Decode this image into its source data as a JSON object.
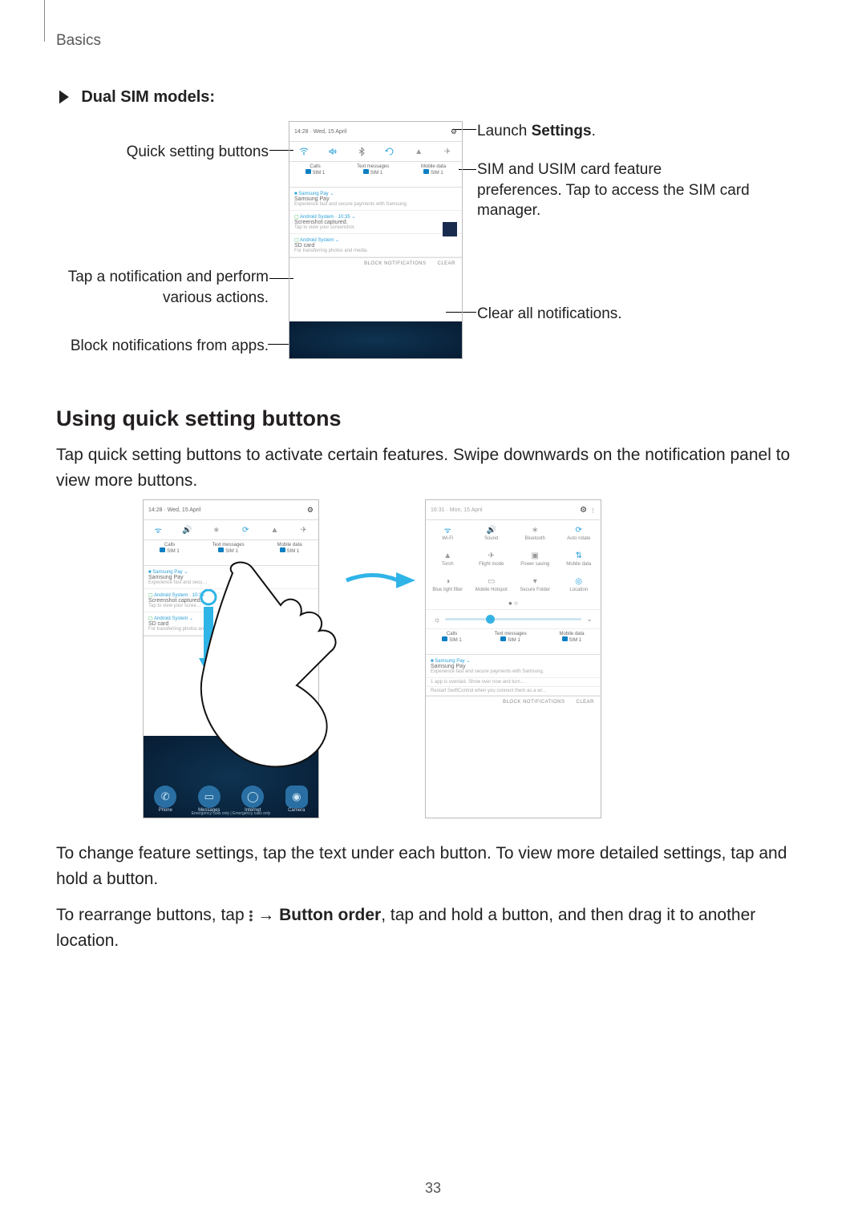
{
  "section_label": "Basics",
  "subhead_marker": "►",
  "subhead_text": "Dual SIM models:",
  "fig1": {
    "callouts": {
      "quick_settings": "Quick setting buttons",
      "tap_notification": "Tap a notification and perform various actions.",
      "block_notifications": "Block notifications from apps.",
      "launch_settings": "Launch Settings.",
      "sim_prefs": "SIM and USIM card feature preferences. Tap to access the SIM card manager.",
      "clear_all": "Clear all notifications."
    },
    "statusbar_time": "14:28",
    "statusbar_date": "Wed, 15 April",
    "sim_labels": [
      "Calls",
      "Text messages",
      "Mobile data"
    ],
    "sim_name": "SIM 1",
    "notifications": [
      {
        "app": "Samsung Pay",
        "title": "Samsung Pay",
        "body": "Experience fast and secure payments with Samsung."
      },
      {
        "app": "Android System · 10:35",
        "title": "Screenshot captured.",
        "body": "Tap to view your screenshot.",
        "thumb": true
      },
      {
        "app": "Android System",
        "title": "SD card",
        "body": "For transferring photos and media."
      }
    ],
    "footer": {
      "block": "BLOCK NOTIFICATIONS",
      "clear": "CLEAR"
    }
  },
  "h2_using": "Using quick setting buttons",
  "p_using": "Tap quick setting buttons to activate certain features. Swipe downwards on the notification panel to view more buttons.",
  "fig2": {
    "qs_grid_labels": [
      "Wi-Fi",
      "Sound",
      "Bluetooth",
      "Auto rotate",
      "Torch",
      "Flight mode",
      "Power saving",
      "Mobile data",
      "Blue light filter",
      "Mobile Hotspot",
      "Secure Folder",
      "Location"
    ],
    "home_apps": [
      "Phone",
      "Messages",
      "Internet",
      "Camera"
    ],
    "bottom_text": "Emergency calls only | Emergency calls only"
  },
  "p_change": "To change feature settings, tap the text under each button. To view more detailed settings, tap and hold a button.",
  "p_rearrange_1": "To rearrange buttons, tap ",
  "p_rearrange_2": " → ",
  "p_rearrange_bold": "Button order",
  "p_rearrange_3": ", tap and hold a button, and then drag it to another location.",
  "page_number": "33",
  "icons": {
    "wifi": "wifi",
    "sound": "sound",
    "bluetooth": "bt",
    "rotate": "rotate",
    "torch": "torch",
    "plane": "plane"
  }
}
